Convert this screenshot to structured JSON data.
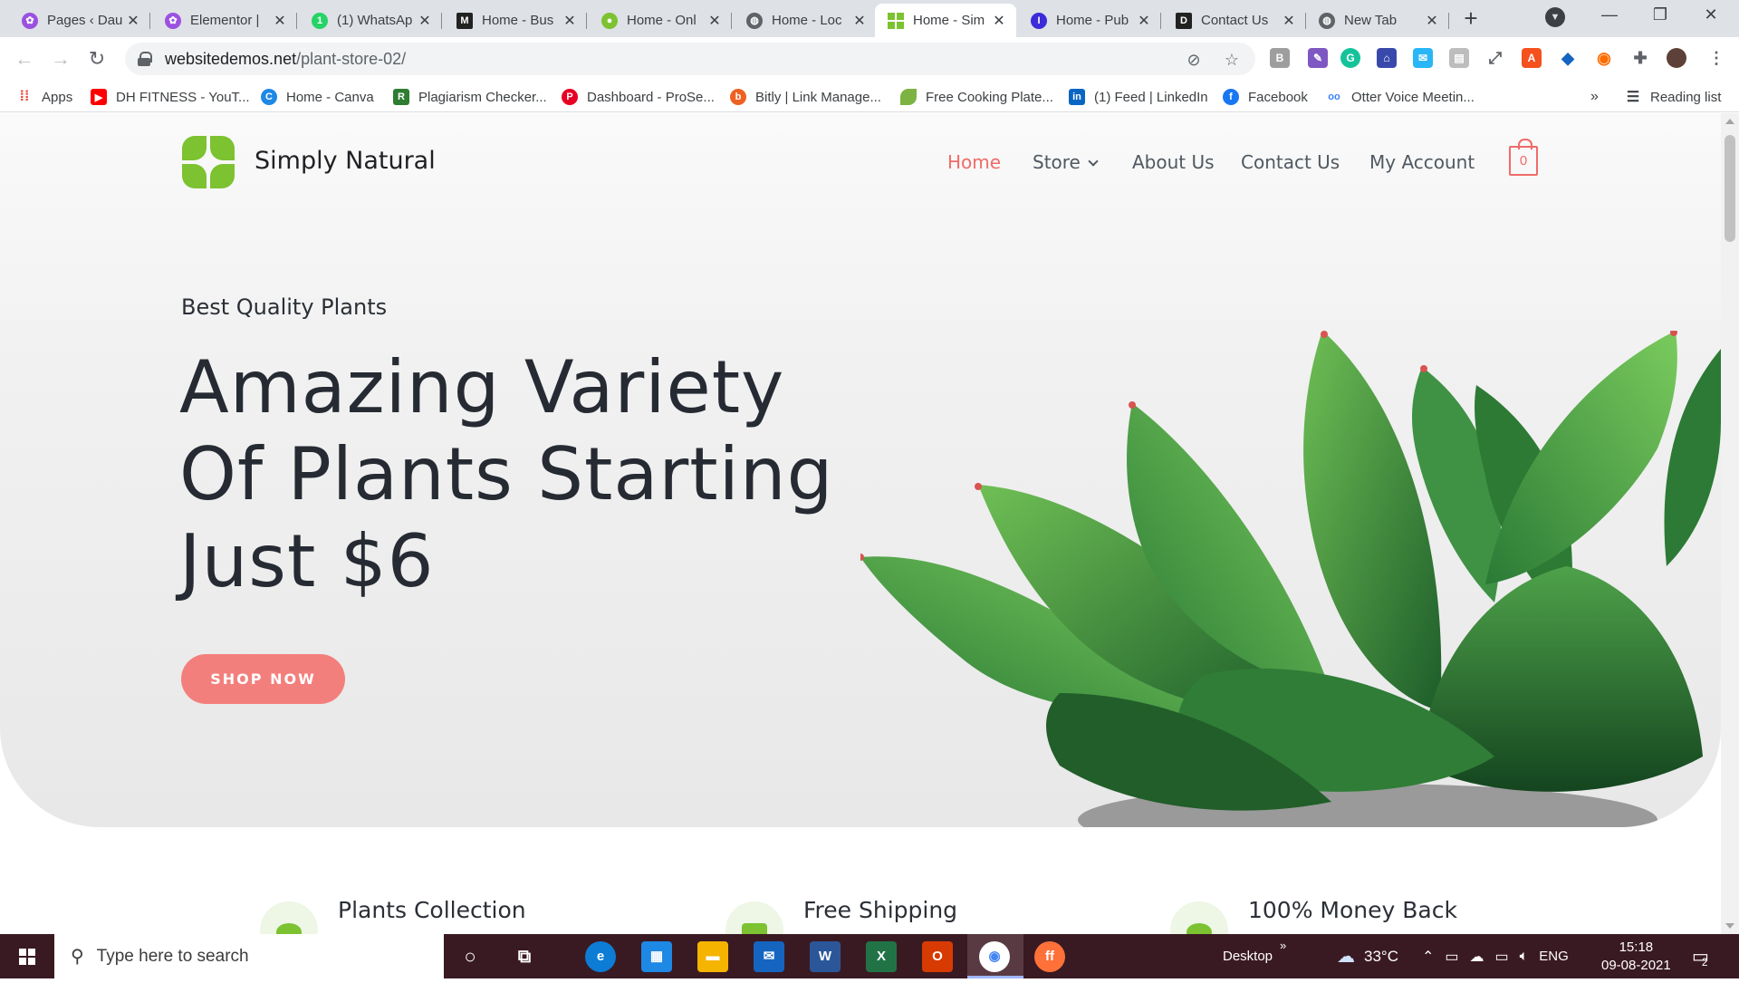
{
  "browser": {
    "tabs": [
      {
        "title": "Pages ‹ Dau",
        "favicon_color": "#9b51e0",
        "favicon_glyph": "✿"
      },
      {
        "title": "Elementor |",
        "favicon_color": "#9b51e0",
        "favicon_glyph": "✿"
      },
      {
        "title": "(1) WhatsAp",
        "favicon_color": "#25d366",
        "favicon_glyph": "1"
      },
      {
        "title": "Home - Bus",
        "favicon_color": "#222222",
        "favicon_glyph": "M"
      },
      {
        "title": "Home - Onl",
        "favicon_color": "#7cc231",
        "favicon_glyph": "●"
      },
      {
        "title": "Home - Loc",
        "favicon_color": "#5f6368",
        "favicon_glyph": "◍"
      },
      {
        "title": "Home - Sim",
        "favicon_color": "#7cc231",
        "favicon_glyph": "▦",
        "active": true
      },
      {
        "title": "Home - Pub",
        "favicon_color": "#3b2bd9",
        "favicon_glyph": "I"
      },
      {
        "title": "Contact Us",
        "favicon_color": "#222222",
        "favicon_glyph": "D"
      },
      {
        "title": "New Tab",
        "favicon_color": "#5f6368",
        "favicon_glyph": "◍"
      }
    ],
    "new_tab_glyph": "+",
    "window_controls": {
      "minimize": "—",
      "restore": "❐",
      "close": "✕"
    },
    "url_host": "websitedemos.net",
    "url_path": "/plant-store-02/",
    "reading_list": "Reading list",
    "bookmarks": [
      {
        "label": "Apps",
        "icon_color": "#4285f4",
        "icon": "apps-grid-icon"
      },
      {
        "label": "DH FITNESS - YouT...",
        "icon_color": "#ff0000",
        "icon": "youtube-icon"
      },
      {
        "label": "Home - Canva",
        "icon_color": "#1e88e5",
        "icon": "canva-icon"
      },
      {
        "label": "Plagiarism Checker...",
        "icon_color": "#2e7d32",
        "icon": "pr-icon"
      },
      {
        "label": "Dashboard - ProSe...",
        "icon_color": "#e60023",
        "icon": "pinterest-icon"
      },
      {
        "label": "Bitly | Link Manage...",
        "icon_color": "#ee6123",
        "icon": "bitly-icon"
      },
      {
        "label": "Free Cooking Plate...",
        "icon_color": "#7cb342",
        "icon": "leaf-icon"
      },
      {
        "label": "(1) Feed | LinkedIn",
        "icon_color": "#0a66c2",
        "icon": "linkedin-icon"
      },
      {
        "label": "Facebook",
        "icon_color": "#1877f2",
        "icon": "facebook-icon"
      },
      {
        "label": "Otter Voice Meetin...",
        "icon_color": "#3b82f6",
        "icon": "otter-icon"
      }
    ]
  },
  "site": {
    "brand": "Simply Natural",
    "brand_color": "#7cc231",
    "accent_color": "#ef6b68",
    "nav": {
      "home": "Home",
      "store": "Store",
      "about": "About Us",
      "contact": "Contact Us",
      "account": "My Account"
    },
    "cart_count": "0",
    "hero": {
      "kicker": "Best Quality Plants",
      "headline_1": "Amazing Variety",
      "headline_2": "Of Plants Starting",
      "headline_3": "Just $6",
      "button": "SHOP NOW"
    },
    "features": [
      {
        "title": "Plants Collection"
      },
      {
        "title": "Free Shipping"
      },
      {
        "title": "100% Money Back"
      }
    ]
  },
  "taskbar": {
    "search_placeholder": "Type here to search",
    "desktop_label": "Desktop",
    "weather": "33°C",
    "language": "ENG",
    "time": "15:18",
    "date": "09-08-2021",
    "notification_count": "2"
  }
}
